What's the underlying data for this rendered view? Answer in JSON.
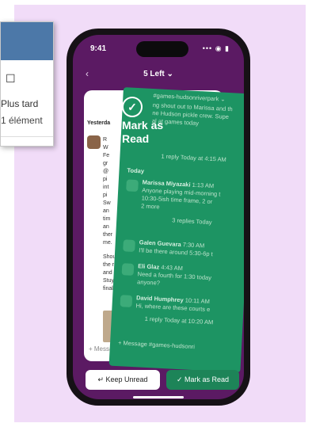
{
  "status": {
    "time": "9:41",
    "icons": "••• ◉ ▮"
  },
  "nav": {
    "back": "‹",
    "title": "5 Left ⌄"
  },
  "back_card": {
    "date": "Yesterda",
    "lines": [
      "R",
      "W",
      "Fe",
      "gr",
      "@",
      "pi",
      "int",
      "pi",
      "Sw",
      "an",
      "tim",
      "an",
      "ther",
      "me.",
      "",
      "Shou",
      "the r",
      "and e",
      "Stuy",
      "final"
    ],
    "input_placeholder": "+  Messag"
  },
  "green_card": {
    "channel": "#games-hudsonriverpark ⌄",
    "intro": [
      "ng shout out to Marissa and th",
      "ne Hudson pickle crew. Supe",
      "al at games today"
    ],
    "reply": "1 reply  Today at 4:15 AM",
    "today": "Today",
    "messages": [
      {
        "name": "Marissa Miyazaki",
        "time": "1:13 AM",
        "lines": [
          "Anyone playing mid-morning t",
          "10:30-5ish time frame, 2 or",
          "2 more"
        ],
        "reactions": "3 replies  Today"
      },
      {
        "name": "Galen Guevara",
        "time": "7:30 AM",
        "lines": [
          "I'll be there around 5:30-6p t"
        ]
      },
      {
        "name": "Eli Glaz",
        "time": "4:43 AM",
        "lines": [
          "Need a fourth for 1:30 today",
          "anyone?"
        ]
      },
      {
        "name": "David Humphrey",
        "time": "10:11 AM",
        "lines": [
          "Hi, where are these courts e"
        ],
        "reactions": "1 reply  Today at 10:20 AM"
      }
    ],
    "input": "+  Message #games-hudsonri"
  },
  "overlay": {
    "check": "✓",
    "title_line1": "Mark as",
    "title_line2": "Read"
  },
  "buttons": {
    "keep_unread": "↵  Keep Unread",
    "mark_read": "✓  Mark as Read"
  },
  "popup": {
    "icon": "☐",
    "label": "Plus tard",
    "count": "1 élément"
  }
}
